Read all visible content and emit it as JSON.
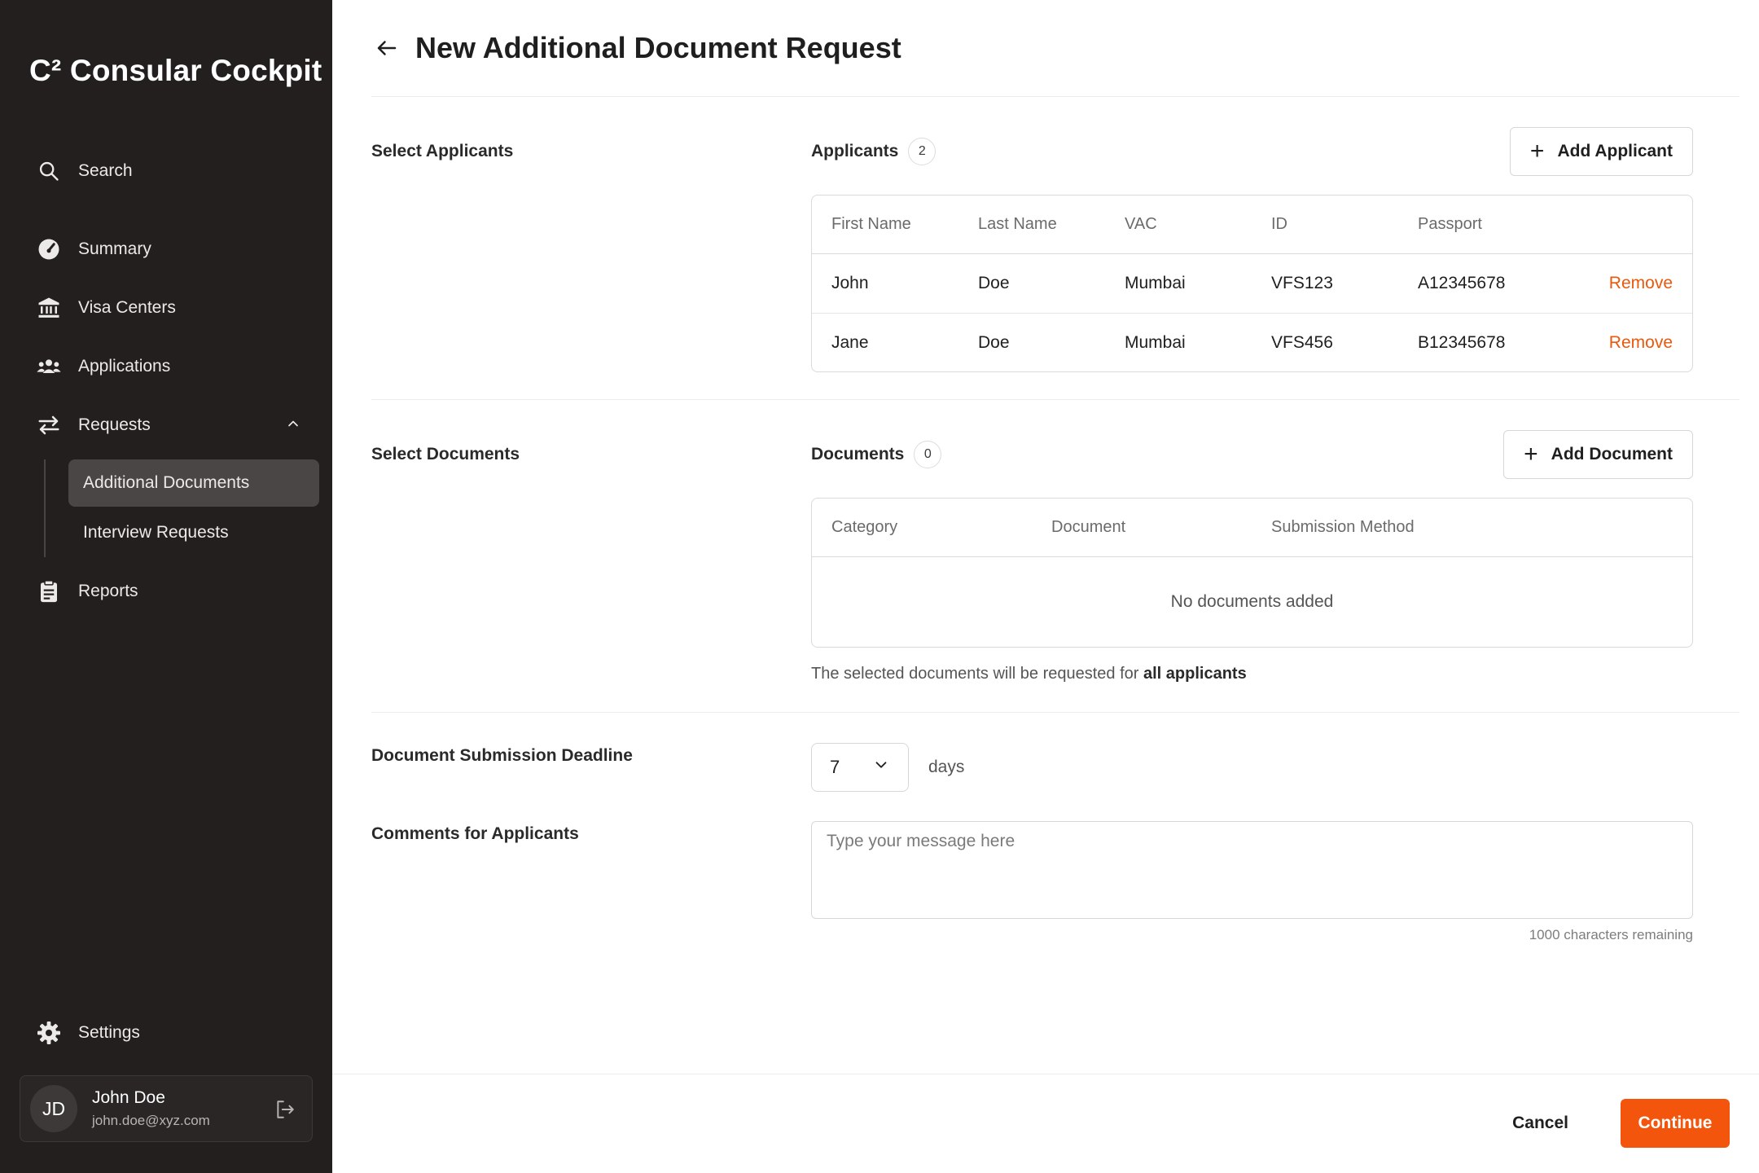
{
  "sidebar": {
    "brand": "C² Consular Cockpit",
    "items": {
      "search": "Search",
      "summary": "Summary",
      "visa_centers": "Visa Centers",
      "applications": "Applications",
      "requests": "Requests",
      "reports": "Reports",
      "settings": "Settings"
    },
    "subitems": {
      "additional_documents": "Additional Documents",
      "interview_requests": "Interview Requests"
    },
    "user": {
      "initials": "JD",
      "name": "John Doe",
      "email": "john.doe@xyz.com"
    }
  },
  "header": {
    "title": "New Additional Document Request"
  },
  "applicants_section": {
    "label": "Select Applicants",
    "list_label": "Applicants",
    "count": "2",
    "add_button": "Add Applicant",
    "columns": [
      "First Name",
      "Last Name",
      "VAC",
      "ID",
      "Passport"
    ],
    "rows": [
      {
        "first": "John",
        "last": "Doe",
        "vac": "Mumbai",
        "id": "VFS123",
        "passport": "A12345678",
        "action": "Remove"
      },
      {
        "first": "Jane",
        "last": "Doe",
        "vac": "Mumbai",
        "id": "VFS456",
        "passport": "B12345678",
        "action": "Remove"
      }
    ]
  },
  "documents_section": {
    "label": "Select Documents",
    "list_label": "Documents",
    "count": "0",
    "add_button": "Add Document",
    "columns": [
      "Category",
      "Document",
      "Submission Method"
    ],
    "empty_text": "No documents added",
    "note_prefix": "The selected documents will be requested for ",
    "note_bold": "all applicants"
  },
  "deadline": {
    "label": "Document Submission Deadline",
    "value": "7",
    "unit": "days"
  },
  "comments": {
    "label": "Comments for Applicants",
    "placeholder": "Type your message here",
    "remaining": "1000 characters remaining"
  },
  "footer": {
    "cancel": "Cancel",
    "continue": "Continue"
  },
  "colors": {
    "sidebar_bg": "#231f1f",
    "accent": "#f3550c",
    "remove_text": "#ea580c"
  }
}
